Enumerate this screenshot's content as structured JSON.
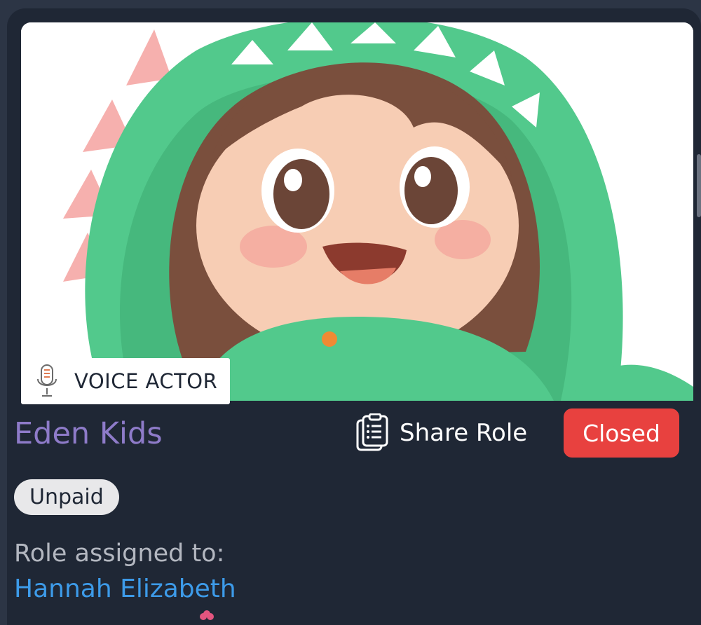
{
  "card": {
    "image": {
      "alt": "cartoon girl in green dinosaur hoodie"
    },
    "role_type": {
      "label": "VOICE ACTOR",
      "icon": "microphone-icon"
    },
    "project_title": "Eden Kids",
    "share": {
      "label": "Share Role",
      "icon": "clipboard-list-icon"
    },
    "status": {
      "label": "Closed",
      "color": "#e8413f"
    },
    "pay": {
      "label": "Unpaid"
    },
    "assignment": {
      "label": "Role assigned to:",
      "assignee": "Hannah Elizabeth"
    }
  },
  "colors": {
    "background": "#2c3545",
    "card": "#1f2735",
    "title": "#8e7bc9",
    "link": "#3d9be9",
    "status": "#e8413f"
  }
}
